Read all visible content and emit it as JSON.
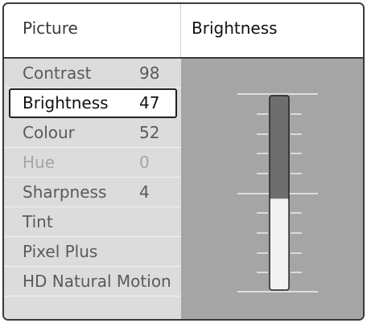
{
  "header": {
    "menu_title": "Picture",
    "selected_item": "Brightness"
  },
  "menu": {
    "items": [
      {
        "label": "Contrast",
        "value": "98",
        "state": "normal"
      },
      {
        "label": "Brightness",
        "value": "47",
        "state": "selected"
      },
      {
        "label": "Colour",
        "value": "52",
        "state": "normal"
      },
      {
        "label": "Hue",
        "value": "0",
        "state": "disabled"
      },
      {
        "label": "Sharpness",
        "value": "4",
        "state": "normal"
      },
      {
        "label": "Tint",
        "value": "",
        "state": "normal"
      },
      {
        "label": "Pixel Plus",
        "value": "",
        "state": "normal"
      },
      {
        "label": "HD Natural Motion",
        "value": "",
        "state": "normal"
      }
    ]
  },
  "slider": {
    "level_fraction": 0.47,
    "fill_color": "#f2f2f2",
    "track_color": "#6e6e6e"
  },
  "colors": {
    "panel_background": "#a5a5a5",
    "menu_background": "#dcdcdc",
    "border": "#222222"
  }
}
